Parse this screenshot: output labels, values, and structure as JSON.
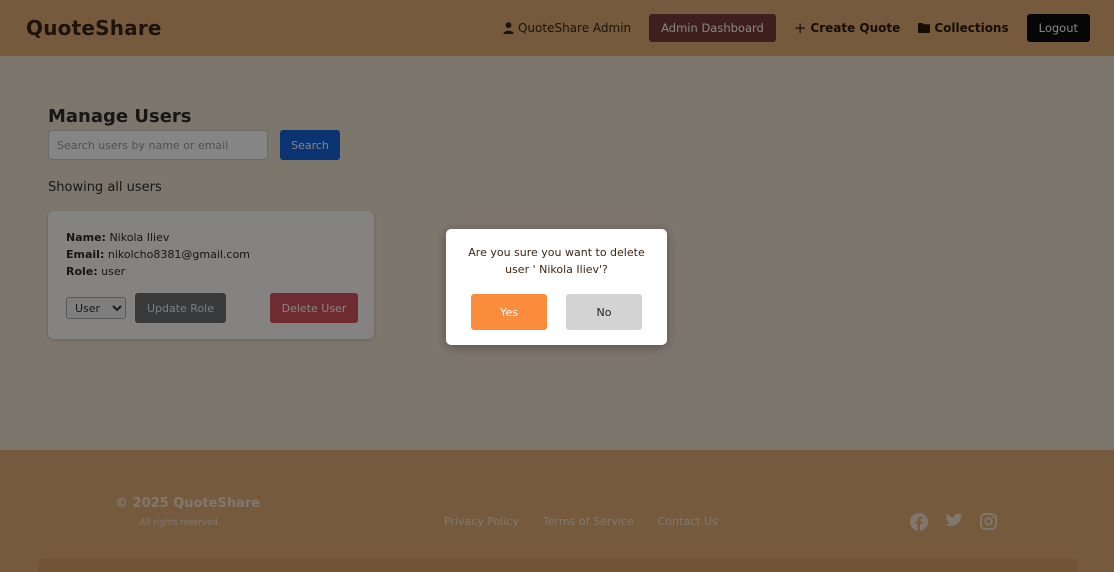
{
  "header": {
    "brand": "QuoteShare",
    "user_label": "QuoteShare Admin",
    "user_icon": "user-icon",
    "admin_dashboard_label": "Admin Dashboard",
    "create_quote_label": "Create Quote",
    "collections_label": "Collections",
    "collections_icon": "folder-icon",
    "logout_label": "Logout"
  },
  "main": {
    "title": "Manage Users",
    "search_placeholder": "Search users by name or email",
    "search_value": "",
    "search_label": "Search",
    "showing_text": "Showing all users",
    "users": [
      {
        "name_label": "Name:",
        "name": "Nikola Iliev",
        "email_label": "Email:",
        "email": "nikolcho8381@gmail.com",
        "role_label": "Role:",
        "role": "user",
        "selected_role": "User",
        "update_label": "Update Role",
        "delete_label": "Delete User"
      }
    ]
  },
  "modal": {
    "message": "Are you sure you want to delete user ' Nikola Iliev'?",
    "yes_label": "Yes",
    "no_label": "No"
  },
  "footer": {
    "copyright": "© 2025 QuoteShare",
    "rights": "All rights reserved.",
    "links": [
      "Privacy Policy",
      "Terms of Service",
      "Contact Us"
    ],
    "social_icons": [
      "facebook-icon",
      "twitter-icon",
      "instagram-icon"
    ]
  },
  "colors": {
    "header_bg": "#e1ad78",
    "admin_button": "#7a3b3b",
    "search_button": "#1565d8",
    "delete_button": "#d4555e",
    "yes_button": "#fb8c3c"
  }
}
